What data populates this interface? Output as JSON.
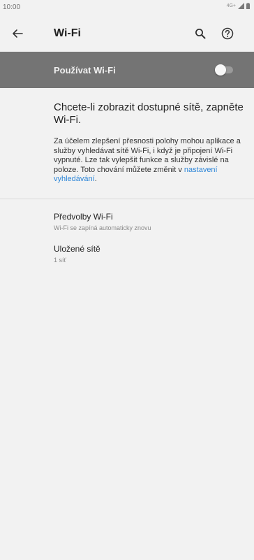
{
  "status_bar": {
    "time": "10:00",
    "network": "4G+"
  },
  "app_bar": {
    "title": "Wi-Fi",
    "icons": [
      "back-arrow-icon",
      "search-icon",
      "help-icon"
    ]
  },
  "master_switch": {
    "label": "Používat Wi-Fi",
    "checked": false,
    "colors": {
      "background": "#747474",
      "text": "#f0f0f0"
    }
  },
  "off_message": {
    "heading": "Chcete-li zobrazit dostupné sítě, zapněte Wi-Fi.",
    "info": "Za účelem zlepšení přesnosti polohy mohou aplikace a služby vyhledávat sítě Wi-Fi, i když je připojení Wi-Fi vypnuté. Lze tak vylepšit funkce a služby závislé na poloze. Toto chování můžete změnit v ",
    "link": "nastavení vyhledávání",
    "info_end": "."
  },
  "preferences": [
    {
      "title": "Předvolby Wi-Fi",
      "subtitle": "Wi-Fi se zapíná automaticky znovu"
    },
    {
      "title": "Uložené sítě",
      "subtitle": "1 síť"
    }
  ],
  "colors": {
    "link": "#2d86d8",
    "background": "#f2f2f2"
  }
}
